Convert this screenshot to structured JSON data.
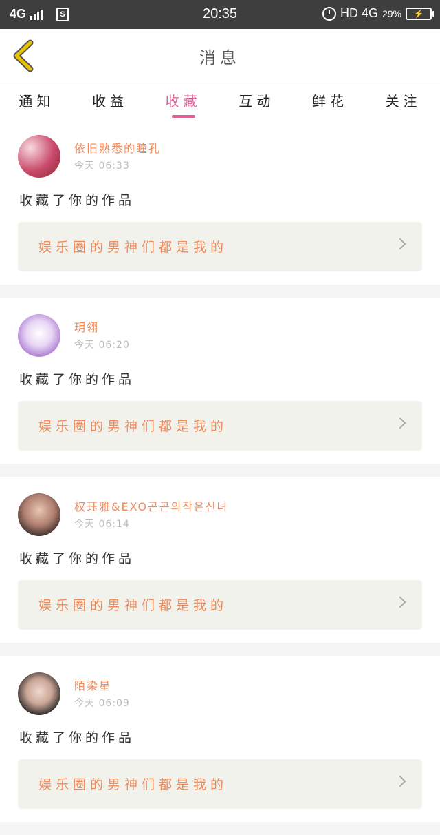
{
  "status": {
    "network": "4G",
    "time": "20:35",
    "right_net": "HD 4G",
    "battery": "29%"
  },
  "header": {
    "title": "消息"
  },
  "tabs": [
    "通知",
    "收益",
    "收藏",
    "互动",
    "鲜花",
    "关注"
  ],
  "active_tab": "收藏",
  "items": [
    {
      "name": "依旧熟悉的瞳孔",
      "time": "今天 06:33",
      "action": "收藏了你的作品",
      "work": "娱乐圈的男神们都是我的"
    },
    {
      "name": "玥翎",
      "time": "今天 06:20",
      "action": "收藏了你的作品",
      "work": "娱乐圈的男神们都是我的"
    },
    {
      "name": "权珏雅&EXO곤곤의작은선녀",
      "time": "今天 06:14",
      "action": "收藏了你的作品",
      "work": "娱乐圈的男神们都是我的"
    },
    {
      "name": "陌染星",
      "time": "今天 06:09",
      "action": "收藏了你的作品",
      "work": "娱乐圈的男神们都是我的"
    }
  ],
  "colors": {
    "accent": "#e0619a",
    "orange": "#f08a5a",
    "back_yellow": "#e6c200"
  }
}
